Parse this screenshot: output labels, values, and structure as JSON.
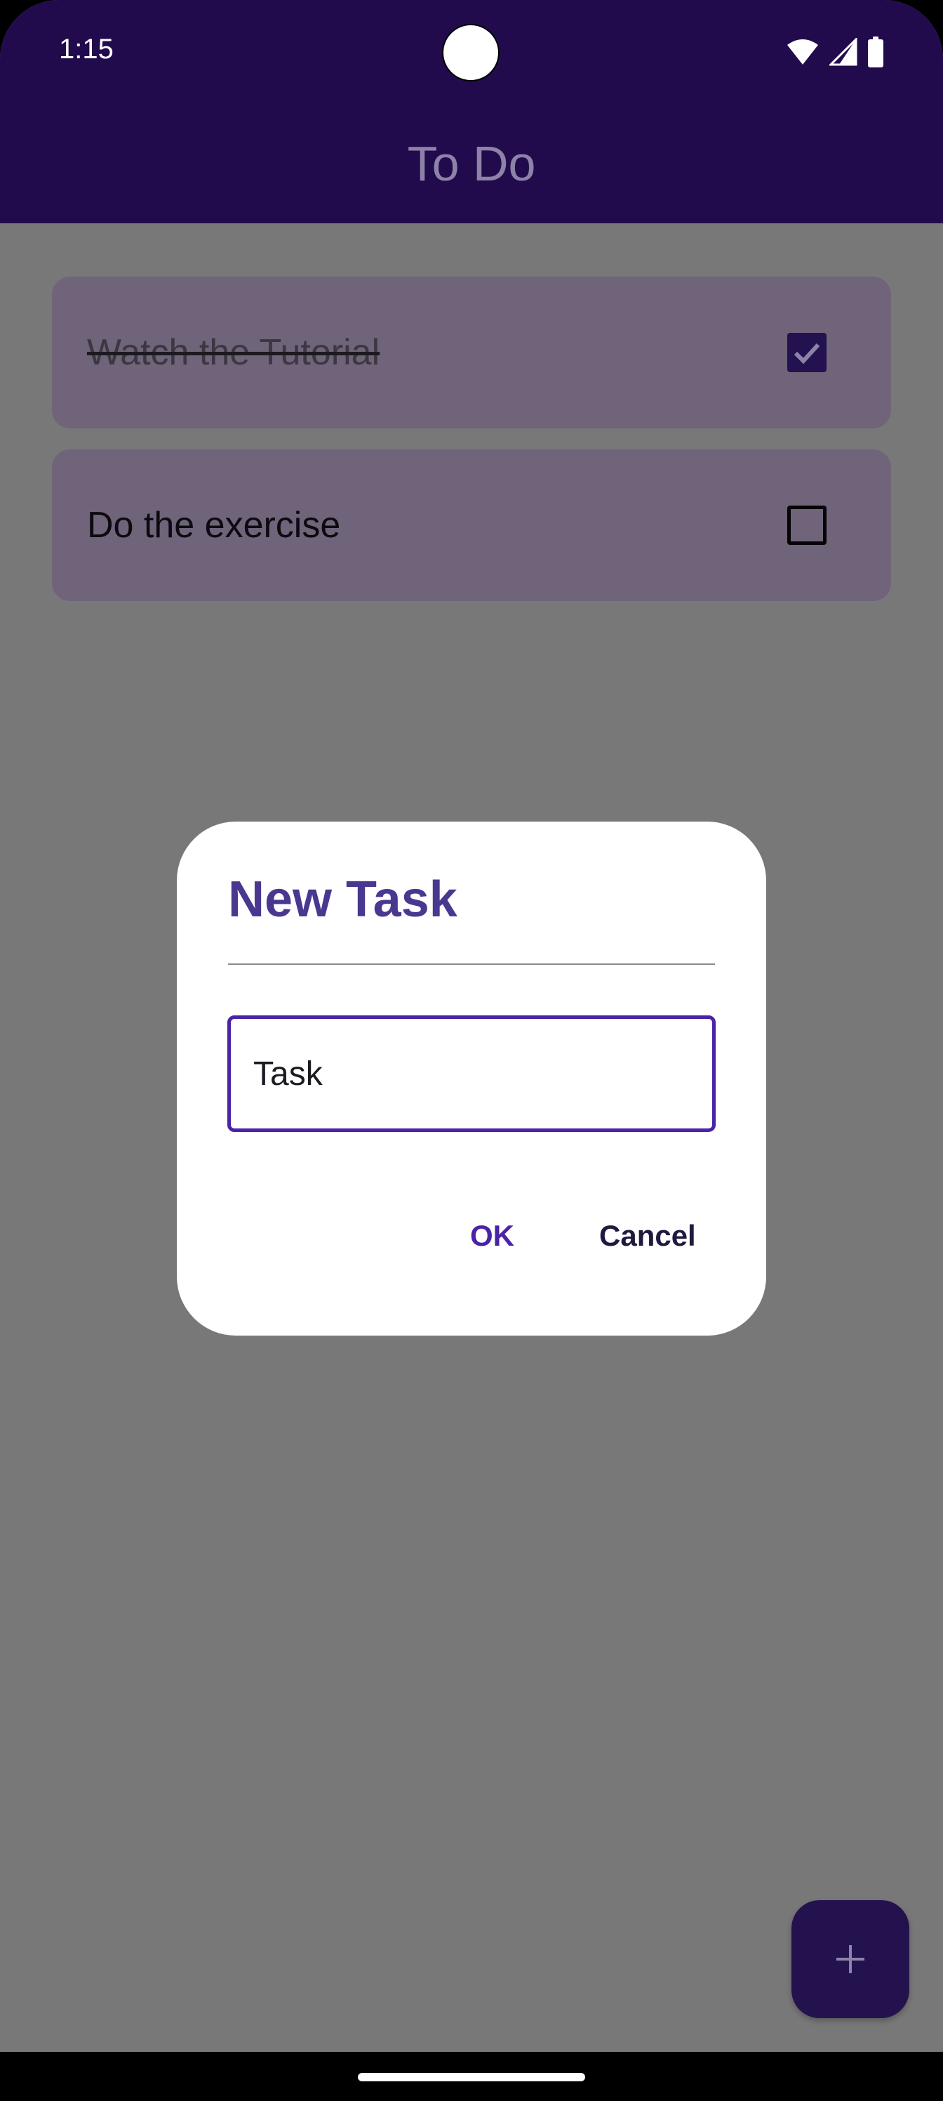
{
  "status_bar": {
    "time": "1:15",
    "icons": [
      "wifi-icon",
      "signal-icon",
      "battery-icon"
    ]
  },
  "app_bar": {
    "title": "To Do"
  },
  "tasks": [
    {
      "label": "Watch the Tutorial",
      "checked": true
    },
    {
      "label": "Do the exercise",
      "checked": false
    }
  ],
  "dialog": {
    "title": "New Task",
    "input_value": "Task",
    "ok_label": "OK",
    "cancel_label": "Cancel"
  },
  "fab": {
    "icon": "plus-icon"
  },
  "colors": {
    "app_bar": "#220b4c",
    "accent": "#4a23a6",
    "scrim": "#787878"
  }
}
